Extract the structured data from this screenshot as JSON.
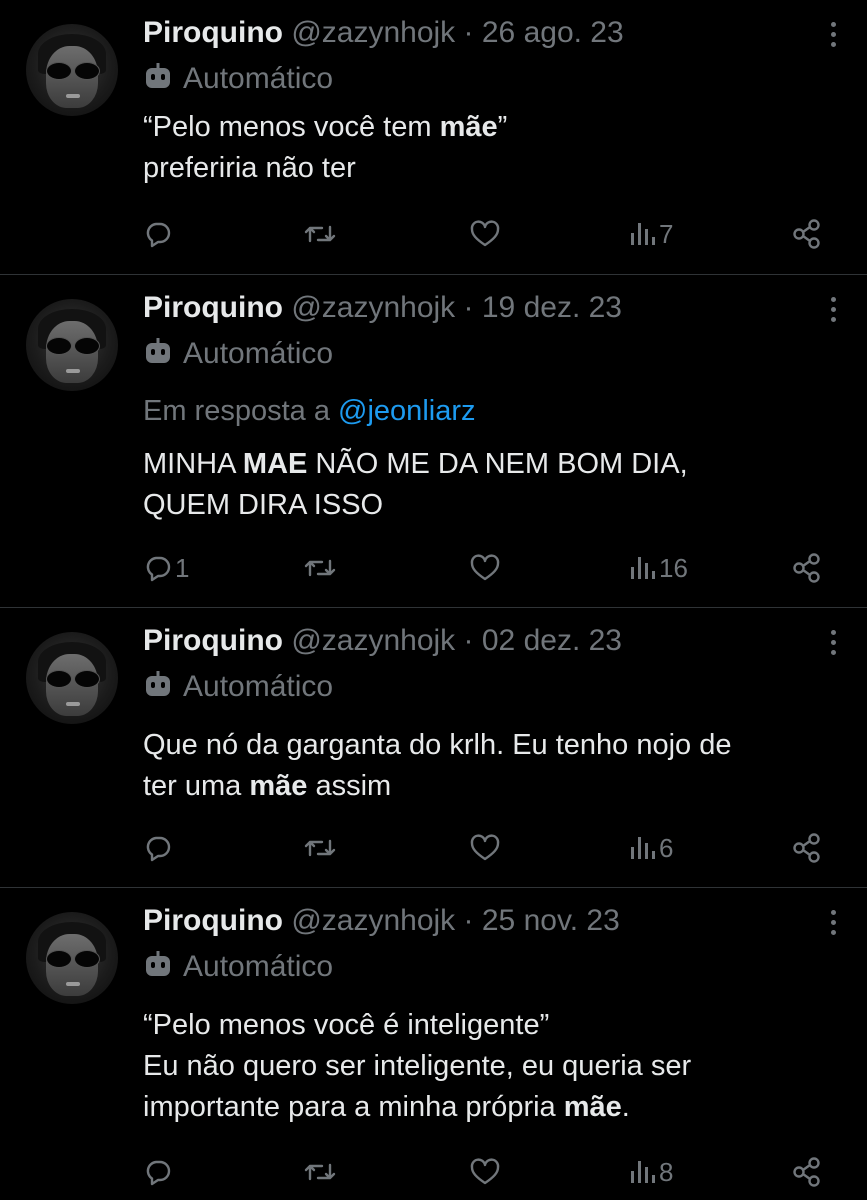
{
  "tweets": [
    {
      "name": "Piroquino",
      "handle": "@zazynhojk",
      "separator": "·",
      "date": "26 ago. 23",
      "automated_label": "Automático",
      "reply_prefix": "",
      "reply_mention": "",
      "lines": [
        [
          {
            "t": "“Pelo menos você tem "
          },
          {
            "t": "mãe",
            "b": true
          },
          {
            "t": "”"
          }
        ],
        [
          {
            "t": "preferiria não ter"
          }
        ]
      ],
      "replies": "",
      "views": "7"
    },
    {
      "name": "Piroquino",
      "handle": "@zazynhojk",
      "separator": "·",
      "date": "19 dez. 23",
      "automated_label": "Automático",
      "reply_prefix": "Em resposta a",
      "reply_mention": "@jeonliarz",
      "lines": [
        [
          {
            "t": "MINHA "
          },
          {
            "t": "MAE",
            "b": true
          },
          {
            "t": " NÃO ME DA NEM BOM DIA,"
          }
        ],
        [
          {
            "t": "QUEM DIRA ISSO"
          }
        ]
      ],
      "replies": "1",
      "views": "16"
    },
    {
      "name": "Piroquino",
      "handle": "@zazynhojk",
      "separator": "·",
      "date": "02 dez. 23",
      "automated_label": "Automático",
      "reply_prefix": "",
      "reply_mention": "",
      "lines": [
        [
          {
            "t": "Que nó da garganta do krlh. Eu tenho nojo de"
          }
        ],
        [
          {
            "t": "ter uma "
          },
          {
            "t": "mãe",
            "b": true
          },
          {
            "t": " assim"
          }
        ]
      ],
      "replies": "",
      "views": "6"
    },
    {
      "name": "Piroquino",
      "handle": "@zazynhojk",
      "separator": "·",
      "date": "25 nov. 23",
      "automated_label": "Automático",
      "reply_prefix": "",
      "reply_mention": "",
      "lines": [
        [
          {
            "t": "“Pelo menos você é inteligente”"
          }
        ],
        [
          {
            "t": "Eu não quero ser inteligente, eu queria ser"
          }
        ],
        [
          {
            "t": "importante para a minha própria "
          },
          {
            "t": "mãe",
            "b": true
          },
          {
            "t": "."
          }
        ]
      ],
      "replies": "",
      "views": "8"
    }
  ],
  "icons": {
    "automated": "bot-icon",
    "reply": "reply-icon",
    "retweet": "retweet-icon",
    "like": "heart-icon",
    "views": "views-icon",
    "share": "share-icon",
    "more": "more-icon"
  },
  "colors": {
    "background": "#000000",
    "text": "#e7e9ea",
    "secondary": "#71767b",
    "link": "#1d9bf0",
    "divider": "#2f3336"
  }
}
